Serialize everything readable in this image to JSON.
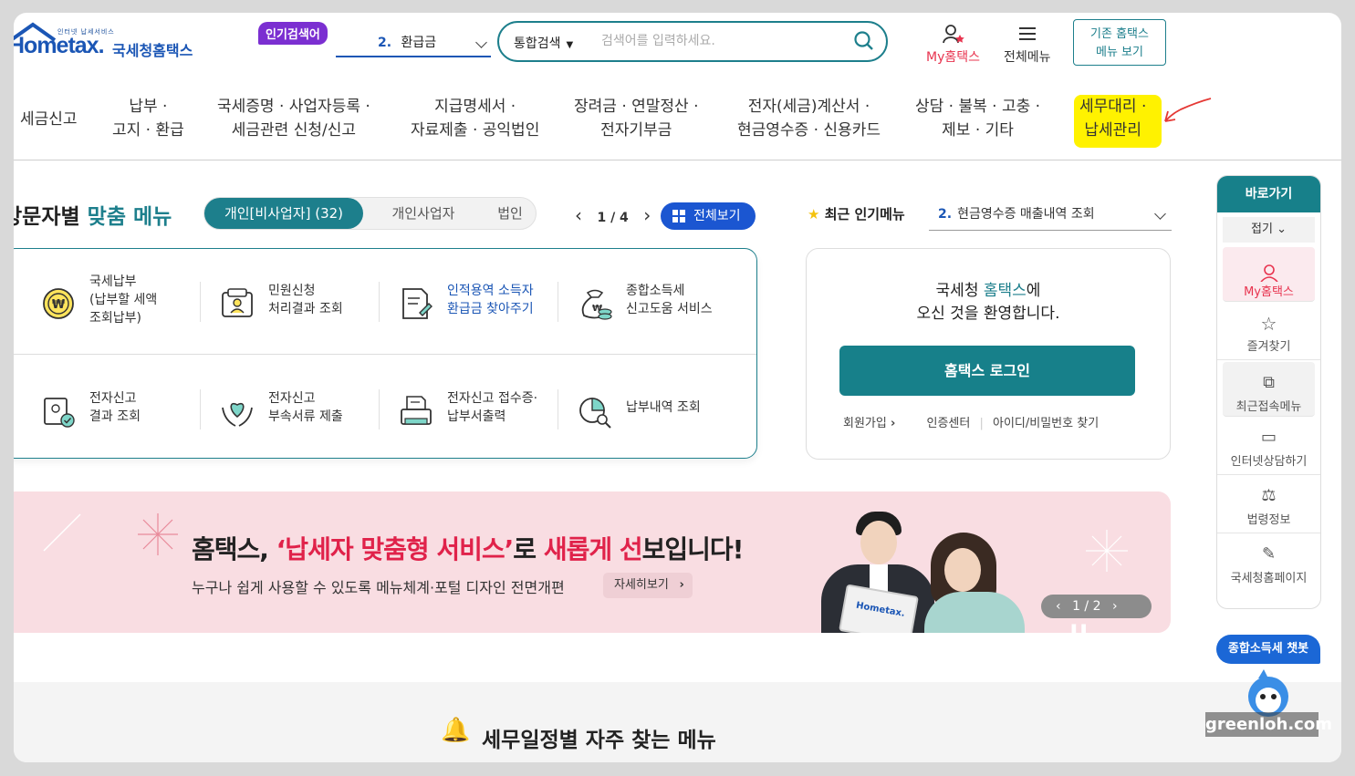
{
  "header": {
    "logo_small": "인터넷 납세서비스",
    "logo_main": "Hometax.",
    "logo_kr": "국세청홈택스",
    "popular_badge": "인기검색어",
    "popular_num": "2.",
    "popular_term": "환급금",
    "search_scope": "통합검색",
    "search_placeholder": "검색어를 입력하세요.",
    "my_hometax": "My홈택스",
    "all_menu": "전체메뉴",
    "old_hometax_line1": "기존 홈택스",
    "old_hometax_line2": "메뉴 보기"
  },
  "nav": {
    "items": [
      "세금신고",
      "납부 ·\n고지 · 환급",
      "국세증명 · 사업자등록 ·\n세금관련 신청/신고",
      "지급명세서 ·\n자료제출 · 공익법인",
      "장려금 · 연말정산 ·\n전자기부금",
      "전자(세금)계산서 ·\n현금영수증 · 신용카드",
      "상담 · 불복 · 고충 ·\n제보 · 기타",
      "세무대리 ·\n납세관리"
    ]
  },
  "visitor_menu": {
    "title_a": "방문자별",
    "title_b": "맞춤 메뉴",
    "tabs": [
      "개인[비사업자] (32)",
      "개인사업자",
      "법인"
    ],
    "page": "1 / 4",
    "view_all": "전체보기",
    "cells": [
      {
        "label": "국세납부\n(납부할 세액\n조회납부)",
        "icon": "won-coin-icon"
      },
      {
        "label": "민원신청\n처리결과 조회",
        "icon": "document-person-icon"
      },
      {
        "label": "인적용역 소득자\n환급금 찾아주기",
        "icon": "document-edit-icon"
      },
      {
        "label": "종합소득세\n신고도움 서비스",
        "icon": "money-bag-icon"
      },
      {
        "label": "전자신고\n결과 조회",
        "icon": "report-check-icon"
      },
      {
        "label": "전자신고\n부속서류 제출",
        "icon": "hands-heart-icon"
      },
      {
        "label": "전자신고 접수증·\n납부서출력",
        "icon": "printer-icon"
      },
      {
        "label": "납부내역 조회",
        "icon": "pie-search-icon"
      }
    ]
  },
  "recent": {
    "label": "최근 인기메뉴",
    "num": "2.",
    "value": "현금영수증 매출내역 조회"
  },
  "login": {
    "welcome_a": "국세청 ",
    "welcome_b": "홈택스",
    "welcome_c": "에",
    "welcome_line2": "오신 것을 환영합니다.",
    "button": "홈택스 로그인",
    "signup": "회원가입",
    "cert": "인증센터",
    "find": "아이디/비밀번호 찾기"
  },
  "banner": {
    "t1": "홈택스, ",
    "t2": "‘납세자 맞춤형 서비스’",
    "t3": "로 ",
    "t4": "새롭게 선",
    "t5": "보입니다!",
    "subtitle": "누구나 쉽게 사용할 수 있도록 메뉴체계·포털 디자인 전면개편",
    "more": "자세히보기",
    "pager": "1 / 2",
    "laptop_logo": "Hometax."
  },
  "schedule": {
    "title": "세무일정별 자주 찾는 메뉴"
  },
  "quick": {
    "title": "바로가기",
    "fold": "접기",
    "items": [
      "My홈택스",
      "즐겨찾기",
      "최근접속메뉴",
      "인터넷상담하기",
      "법령정보",
      "국세청홈페이지"
    ]
  },
  "chatbot": "종합소득세 챗봇",
  "watermark": "greenloh.com",
  "colors": {
    "primary": "#17808a",
    "brand": "#1b56b5",
    "accent_red": "#e0224a",
    "highlight": "#fff200",
    "badge": "#7b2fd1"
  }
}
